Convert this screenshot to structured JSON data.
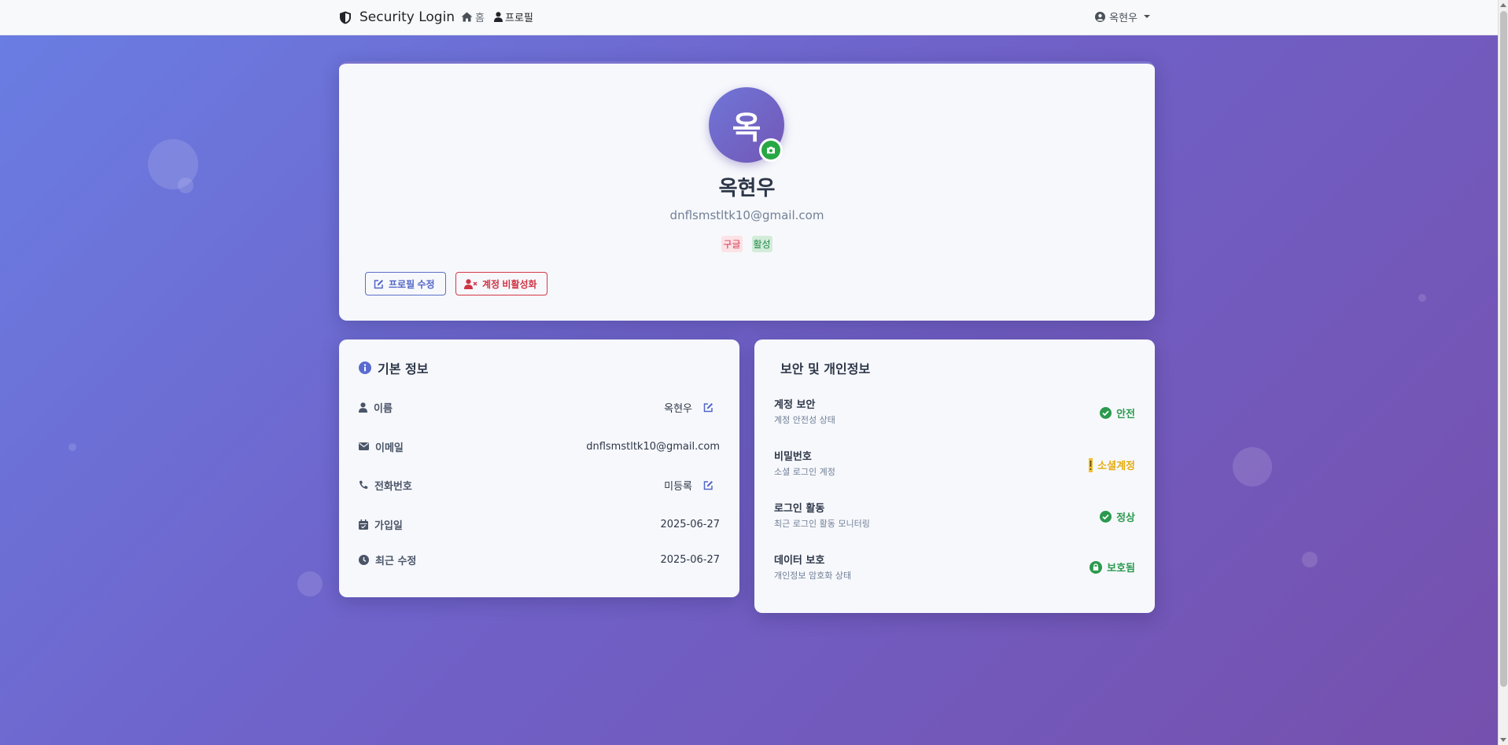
{
  "navbar": {
    "brand": "Security Login",
    "links": [
      {
        "label": "홈",
        "icon": "home-icon"
      },
      {
        "label": "프로필",
        "icon": "user-icon"
      }
    ],
    "user_menu": {
      "label": "옥현우",
      "icon": "user-circle-icon"
    }
  },
  "profile": {
    "avatar_initial": "옥",
    "name": "옥현우",
    "email": "dnflsmstltk10@gmail.com",
    "badges": {
      "provider": "구글",
      "status": "활성"
    },
    "edit_button": "프로필 수정",
    "deactivate_button": "계정 비활성화"
  },
  "basic_info": {
    "title": "기본 정보",
    "rows": [
      {
        "label": "이름",
        "value": "옥현우",
        "editable": true,
        "icon": "user-icon"
      },
      {
        "label": "이메일",
        "value": "dnflsmstltk10@gmail.com",
        "editable": false,
        "icon": "envelope-icon"
      },
      {
        "label": "전화번호",
        "value": "미등록",
        "editable": true,
        "icon": "phone-icon"
      },
      {
        "label": "가입일",
        "value": "2025-06-27",
        "editable": false,
        "icon": "calendar-icon"
      },
      {
        "label": "최근 수정",
        "value": "2025-06-27",
        "editable": false,
        "icon": "clock-icon"
      }
    ]
  },
  "security": {
    "title": "보안 및 개인정보",
    "rows": [
      {
        "title": "계정 보안",
        "desc": "계정 안전성 상태",
        "status": "안전",
        "color": "#2a9a4e",
        "icon": "check-circle-icon"
      },
      {
        "title": "비밀번호",
        "desc": "소셜 로그인 계정",
        "status": "소셜계정",
        "color": "#e5ad10",
        "icon": "exclamation-icon"
      },
      {
        "title": "로그인 활동",
        "desc": "최근 로그인 활동 모니터링",
        "status": "정상",
        "color": "#2a9a4e",
        "icon": "check-circle-icon"
      },
      {
        "title": "데이터 보호",
        "desc": "개인정보 암호화 상태",
        "status": "보호됨",
        "color": "#2a9a4e",
        "icon": "lock-icon"
      }
    ]
  }
}
